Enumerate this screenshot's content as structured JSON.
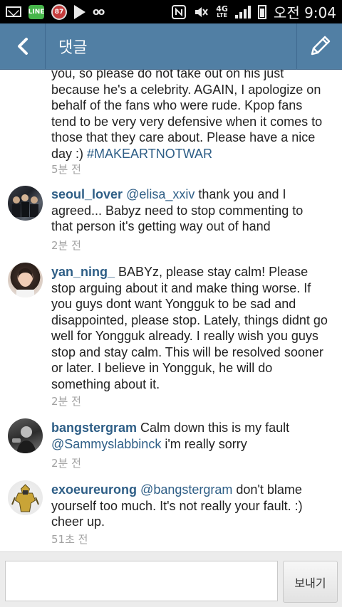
{
  "status_bar": {
    "line_badge": "LINE",
    "notification_badge": "87",
    "network": "4G",
    "network_sub": "LTE",
    "time": "오전 9:04"
  },
  "header": {
    "title": "댓글"
  },
  "comments": [
    {
      "text": "you, so please do not take out on his just because he's a celebrity. AGAIN, I apologize on behalf of the fans who were rude. Kpop fans tend to be very very defensive when it comes to those that they care about. Please have a nice day :) ",
      "hashtag": "#MAKEARTNOTWAR",
      "time": "5분 전"
    },
    {
      "username": "seoul_lover",
      "mention": "@elisa_xxiv",
      "text": " thank you and I agreed... Babyz need to stop commenting to that person it's getting way out of hand",
      "time": "2분 전"
    },
    {
      "username": "yan_ning_",
      "text": " BABYz, please stay calm! Please stop arguing about it and make thing worse. If you guys dont want Yongguk to be sad and disappointed, please stop. Lately, things didnt go well for Yongguk already. I really wish you guys stop and stay calm. This will be resolved sooner or later. I believe in Yongguk, he will do something about it.",
      "time": "2분 전"
    },
    {
      "username": "bangstergram",
      "text_pre": " Calm down this is my fault ",
      "mention": "@Sammyslabbinck",
      "text": " i'm really sorry",
      "time": "2분 전"
    },
    {
      "username": "exoeureurong",
      "mention": "@bangstergram",
      "text": " don't blame yourself too much. It's not really your fault. :) cheer up.",
      "time": "51초 전"
    }
  ],
  "input": {
    "value": "",
    "placeholder": ""
  },
  "send_button": {
    "label": "보내기"
  },
  "colors": {
    "header_bg": "#517fa4",
    "link": "#2e5e86",
    "time": "#a2a2a2"
  }
}
